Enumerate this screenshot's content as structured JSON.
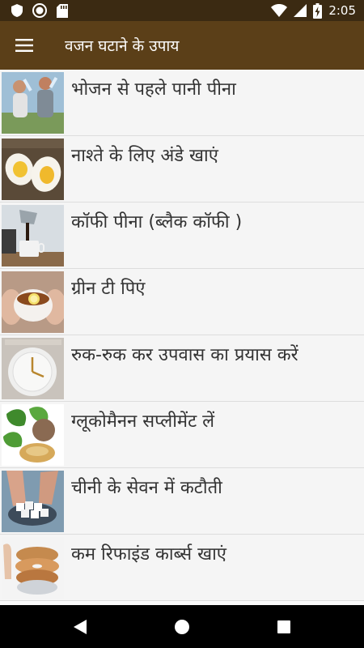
{
  "status_bar": {
    "time": "2:05",
    "icons": [
      "shield-icon",
      "circle-record-icon",
      "sd-card-icon",
      "wifi-icon",
      "signal-icon",
      "battery-charging-icon"
    ]
  },
  "app_bar": {
    "title": "वजन घटाने के उपाय",
    "menu_icon": "hamburger-menu-icon"
  },
  "list": {
    "items": [
      {
        "label": "भोजन से पहले पानी पीना"
      },
      {
        "label": "नाश्ते के लिए अंडे खाएं"
      },
      {
        "label": "कॉफी पीना (ब्लैक कॉफी )"
      },
      {
        "label": "ग्रीन टी पिएं"
      },
      {
        "label": "रुक-रुक कर उपवास का प्रयास करें"
      },
      {
        "label": "ग्लूकोमैनन सप्लीमेंट लें"
      },
      {
        "label": " चीनी के सेवन में कटौती"
      },
      {
        "label": "कम रिफाइंड कार्ब्स खाएं"
      }
    ]
  },
  "nav_bar": {
    "icons": [
      "back-icon",
      "home-icon",
      "recents-icon"
    ]
  }
}
